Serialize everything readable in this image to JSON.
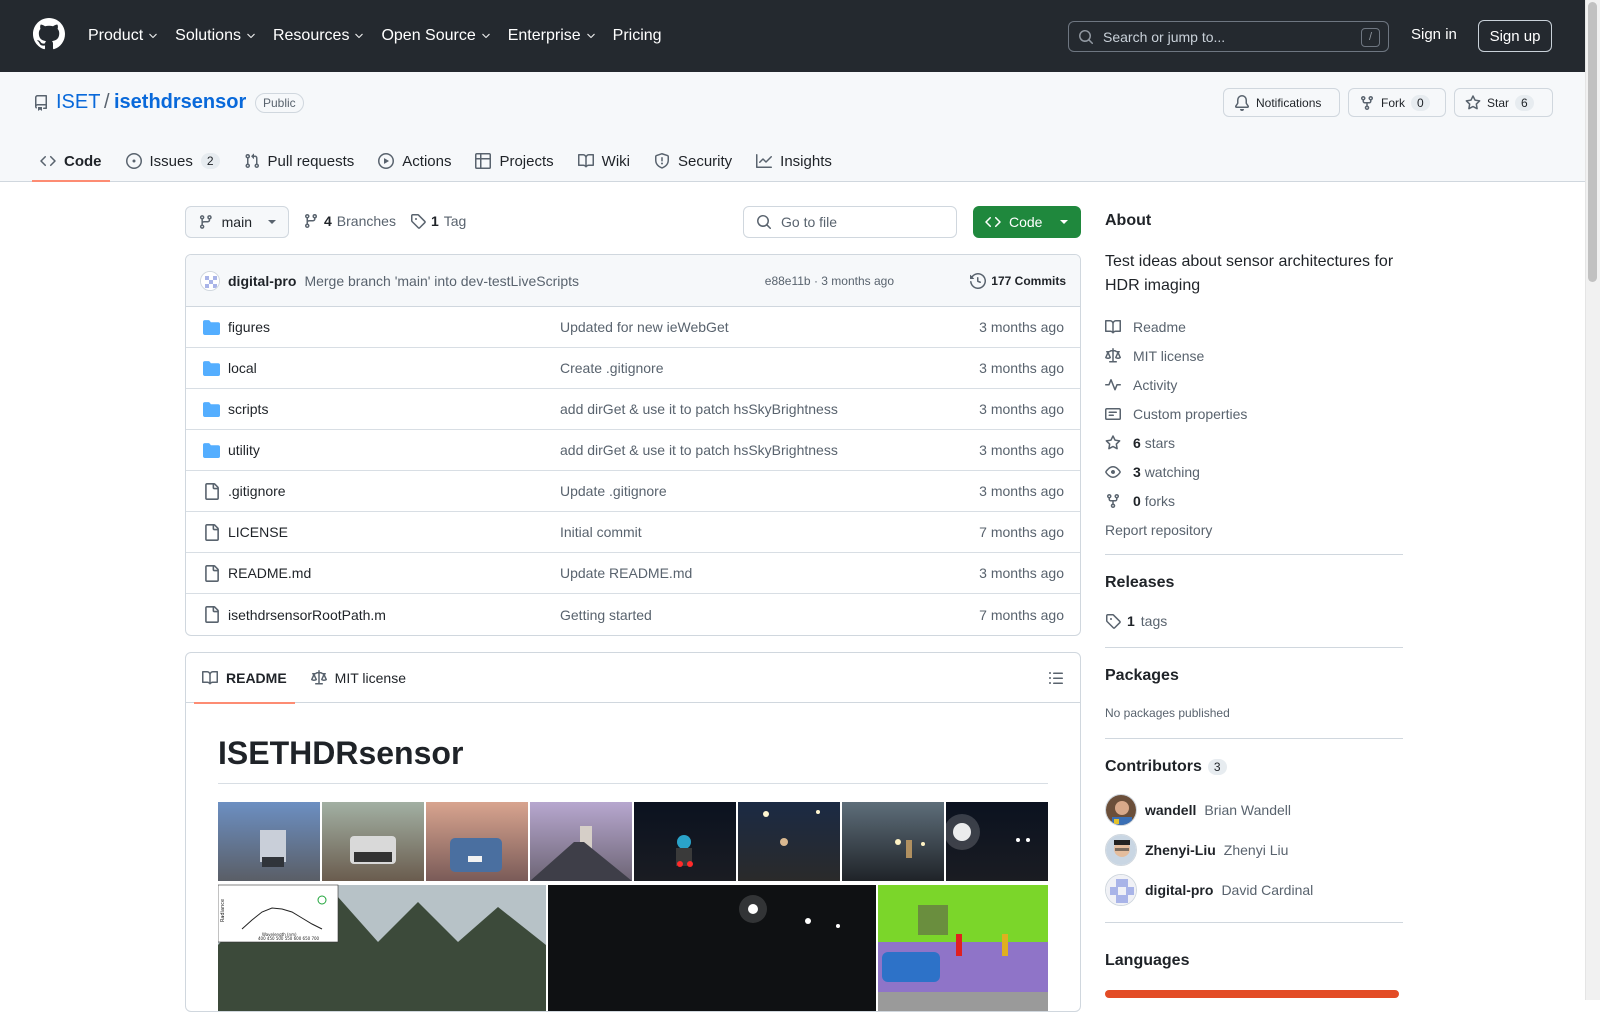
{
  "header": {
    "nav": [
      "Product",
      "Solutions",
      "Resources",
      "Open Source",
      "Enterprise",
      "Pricing"
    ],
    "search_placeholder": "Search or jump to...",
    "search_kbd": "/",
    "signin": "Sign in",
    "signup": "Sign up"
  },
  "repo": {
    "owner": "ISET",
    "slash": "/",
    "name": "isethdrsensor",
    "visibility": "Public",
    "notifications_label": "Notifications",
    "fork_label": "Fork",
    "fork_count": "0",
    "star_label": "Star",
    "star_count": "6"
  },
  "tabs": [
    {
      "label": "Code",
      "icon": "code-icon",
      "count": ""
    },
    {
      "label": "Issues",
      "icon": "issue-icon",
      "count": "2"
    },
    {
      "label": "Pull requests",
      "icon": "pull-request-icon",
      "count": ""
    },
    {
      "label": "Actions",
      "icon": "play-icon",
      "count": ""
    },
    {
      "label": "Projects",
      "icon": "table-icon",
      "count": ""
    },
    {
      "label": "Wiki",
      "icon": "book-icon",
      "count": ""
    },
    {
      "label": "Security",
      "icon": "shield-icon",
      "count": ""
    },
    {
      "label": "Insights",
      "icon": "graph-icon",
      "count": ""
    }
  ],
  "toolbar": {
    "branch": "main",
    "branches_count": "4",
    "branches_label": "Branches",
    "tags_count": "1",
    "tags_label": "Tag",
    "goto_placeholder": "Go to file",
    "code_button": "Code"
  },
  "commit": {
    "author": "digital-pro",
    "message": "Merge branch 'main' into dev-testLiveScripts",
    "meta": "e88e11b · 3 months ago",
    "commits_label": "177 Commits"
  },
  "files": [
    {
      "type": "dir",
      "name": "figures",
      "message": "Updated for new ieWebGet",
      "date": "3 months ago"
    },
    {
      "type": "dir",
      "name": "local",
      "message": "Create .gitignore",
      "date": "3 months ago"
    },
    {
      "type": "dir",
      "name": "scripts",
      "message": "add dirGet & use it to patch hsSkyBrightness",
      "date": "3 months ago"
    },
    {
      "type": "dir",
      "name": "utility",
      "message": "add dirGet & use it to patch hsSkyBrightness",
      "date": "3 months ago"
    },
    {
      "type": "file",
      "name": ".gitignore",
      "message": "Update .gitignore",
      "date": "3 months ago"
    },
    {
      "type": "file",
      "name": "LICENSE",
      "message": "Initial commit",
      "date": "7 months ago"
    },
    {
      "type": "file",
      "name": "README.md",
      "message": "Update README.md",
      "date": "3 months ago"
    },
    {
      "type": "file",
      "name": "isethdrsensorRootPath.m",
      "message": "Getting started",
      "date": "7 months ago"
    }
  ],
  "readme": {
    "tab_readme": "README",
    "tab_license": "MIT license",
    "title": "ISETHDRsensor",
    "inset_ylabel": "Radiance",
    "inset_xlabel": "Wavelength (nm)",
    "inset_ticks": "400 450 500 550 600 650 700"
  },
  "sidebar": {
    "about_title": "About",
    "description": "Test ideas about sensor architectures for HDR imaging",
    "items": [
      {
        "icon": "book-icon",
        "text": "Readme",
        "bold": ""
      },
      {
        "icon": "law-icon",
        "text": "MIT license",
        "bold": ""
      },
      {
        "icon": "pulse-icon",
        "text": "Activity",
        "bold": ""
      },
      {
        "icon": "note-icon",
        "text": "Custom properties",
        "bold": ""
      },
      {
        "icon": "star-icon",
        "text": "stars",
        "bold": "6"
      },
      {
        "icon": "eye-icon",
        "text": "watching",
        "bold": "3"
      },
      {
        "icon": "fork-icon",
        "text": "forks",
        "bold": "0"
      }
    ],
    "report": "Report repository",
    "releases_title": "Releases",
    "releases_count": "1",
    "releases_label": "tags",
    "packages_title": "Packages",
    "packages_empty": "No packages published",
    "contributors_title": "Contributors",
    "contributors_count": "3",
    "contributors": [
      {
        "login": "wandell",
        "name": "Brian Wandell"
      },
      {
        "login": "Zhenyi-Liu",
        "name": "Zhenyi Liu"
      },
      {
        "login": "digital-pro",
        "name": "David Cardinal"
      }
    ],
    "languages_title": "Languages"
  },
  "colors": {
    "accent": "#0969da",
    "primary_button": "#1f883d",
    "tab_underline": "#fd8c73",
    "header_bg": "#24292f",
    "language_bar": "#e34c26"
  }
}
